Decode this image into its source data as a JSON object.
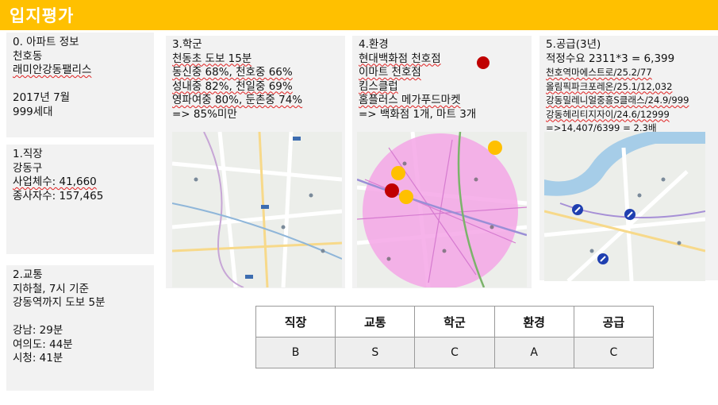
{
  "header": {
    "title": "입지평가",
    "bg_color": "#ffc000"
  },
  "info": {
    "lines": [
      "0. 아파트 정보",
      "천호동",
      "래미안강동팰리스",
      "",
      "2017년 7월",
      "999세대"
    ]
  },
  "job": {
    "lines": [
      "1.직장",
      "강동구",
      "사업체수: 41,660",
      "종사자수: 157,465"
    ]
  },
  "transport": {
    "lines": [
      "2.교통",
      "지하철, 7시 기준",
      "강동역까지 도보 5분",
      "",
      "강남:  29분",
      "여의도: 44분",
      "시청: 41분"
    ]
  },
  "school": {
    "lines": [
      "3.학군",
      "천동초 도보 15분",
      "동신중 68%, 천호중 66%",
      "성내중 82%, 천일중 69%",
      "영파여중 80%, 둔촌중 74%",
      "=> 85%미만"
    ]
  },
  "environment": {
    "lines": [
      "4.환경",
      "현대백화점 천호점",
      "이마트 천호점",
      "킴스클럽",
      "홈플러스 메가푸드마켓",
      "=> 백화점 1개, 마트 3개"
    ]
  },
  "supply": {
    "lines": [
      "5.공급(3년)",
      "적정수요 2311*3 = 6,399",
      "천호역마에스트로/25.2/77",
      "올림픽파크포레온/25.1/12,032",
      "강동밀레니얼중흥S클래스/24.9/999",
      "강동헤리티지자이/24.6/12999",
      "=>14,407/6399 = 2.3배"
    ]
  },
  "grades": {
    "headers": [
      "직장",
      "교통",
      "학군",
      "환경",
      "공급"
    ],
    "values": [
      "B",
      "S",
      "C",
      "A",
      "C"
    ]
  },
  "colors": {
    "dept_store_marker": "#c00000",
    "mart_marker": "#ffc000",
    "radius_circle": "#f4a6e6",
    "river": "#a6cde8"
  },
  "icons": [
    "map-pin-icon"
  ]
}
